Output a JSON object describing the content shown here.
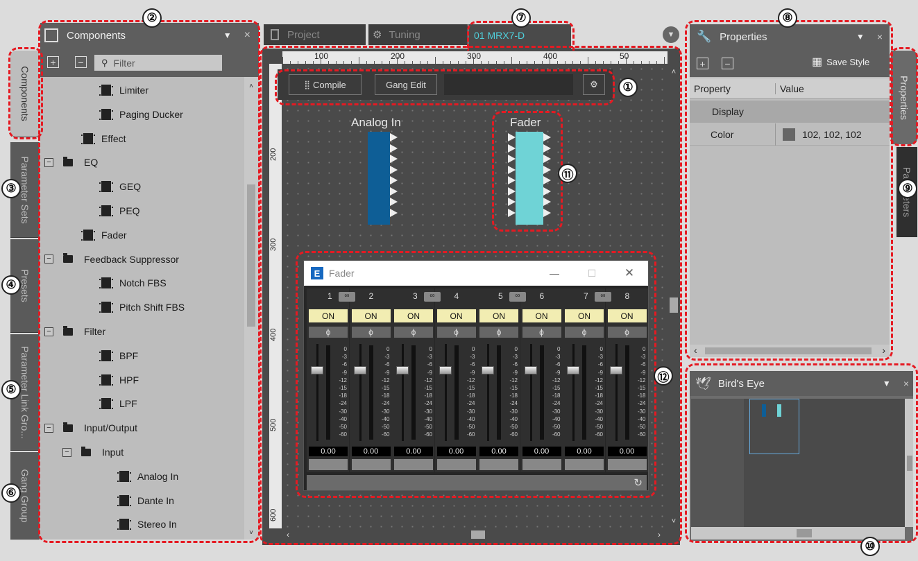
{
  "side_tabs": {
    "components": "Components",
    "parameter_sets": "Parameter Sets",
    "presets": "Presets",
    "link_groups": "Parameter Link Gro...",
    "gang_group": "Gang Group"
  },
  "components": {
    "title": "Components",
    "pin": "▾",
    "close": "×",
    "add": "+",
    "remove": "−",
    "filter_placeholder": "Filter",
    "items": [
      "Limiter",
      "Paging Ducker",
      "Effect",
      "EQ",
      "GEQ",
      "PEQ",
      "Fader",
      "Feedback Suppressor",
      "Notch FBS",
      "Pitch Shift FBS",
      "Filter",
      "BPF",
      "HPF",
      "LPF",
      "Input/Output",
      "Input",
      "Analog In",
      "Dante In",
      "Stereo In"
    ],
    "expand": "⊟"
  },
  "tabs": {
    "project": "Project",
    "tuning": "Tuning",
    "device": "01 MRX7-D"
  },
  "toolbar": {
    "compile": "Compile",
    "gang_edit": "Gang Edit"
  },
  "ruler_h": [
    "100",
    "200",
    "300",
    "400",
    "50"
  ],
  "ruler_v": [
    "200",
    "300",
    "400",
    "500",
    "600"
  ],
  "blocks": {
    "analog_in": "Analog In",
    "fader": "Fader"
  },
  "fader_window": {
    "title": "Fader",
    "minimize": "—",
    "maximize": "☐",
    "close": "✕",
    "channels": [
      "1",
      "2",
      "3",
      "4",
      "5",
      "6",
      "7",
      "8"
    ],
    "on_label": "ON",
    "phase_label": "ϕ",
    "value": "0.00",
    "scale": [
      "0",
      "-3",
      "-6",
      "-9",
      "-12",
      "-15",
      "-18",
      "-24",
      "-30",
      "-40",
      "-50",
      "-60"
    ]
  },
  "properties": {
    "title": "Properties",
    "save_style": "Save Style",
    "col_property": "Property",
    "col_value": "Value",
    "row_display": "Display",
    "row_color": "Color",
    "color_value": "102, 102, 102"
  },
  "right_tabs": {
    "properties": "Properties",
    "parameters": "Parameters"
  },
  "birds_eye": {
    "title": "Bird's Eye"
  },
  "callouts": [
    "①",
    "②",
    "③",
    "④",
    "⑤",
    "⑥",
    "⑦",
    "⑧",
    "⑨",
    "⑩",
    "⑪",
    "⑫"
  ],
  "colors": {
    "analog_block": "#0e5e96",
    "fader_block": "#6fd3d6",
    "highlight": "#e51a22"
  }
}
